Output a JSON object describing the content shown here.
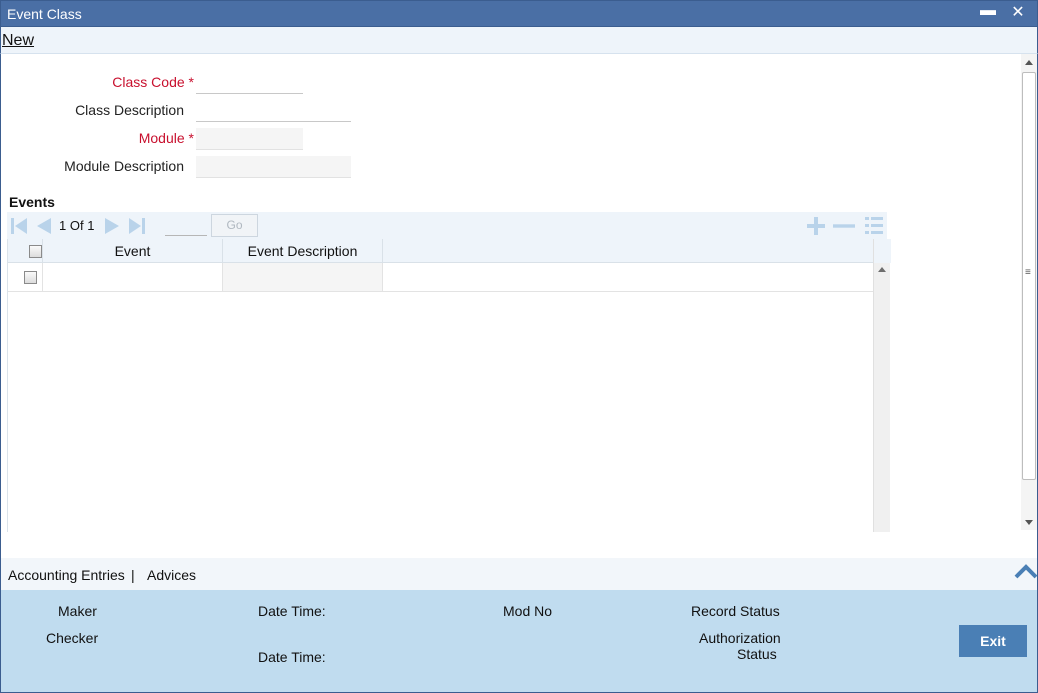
{
  "window": {
    "title": "Event Class",
    "minimize_icon": "minimize-icon",
    "close_icon": "close-icon"
  },
  "menu": {
    "new_label": "New"
  },
  "form": {
    "class_code_label": "Class Code",
    "class_code_value": "",
    "class_description_label": "Class Description",
    "class_description_value": "",
    "module_label": "Module",
    "module_value": "",
    "module_description_label": "Module Description",
    "module_description_value": "",
    "required_marker": "*",
    "required_color": "#c8102e"
  },
  "events": {
    "section_title": "Events",
    "pagination": {
      "current": "1",
      "of_label": "Of",
      "total": "1",
      "go_label": "Go"
    },
    "columns": [
      "Event",
      "Event Description"
    ],
    "rows": [
      {
        "event": "",
        "event_description": ""
      }
    ],
    "icons": [
      "first-page-icon",
      "prev-page-icon",
      "next-page-icon",
      "last-page-icon",
      "add-row-icon",
      "delete-row-icon",
      "single-view-icon"
    ]
  },
  "links": {
    "accounting_entries": "Accounting Entries",
    "separator": "|",
    "advices": "Advices"
  },
  "footer": {
    "maker_label": "Maker",
    "checker_label": "Checker",
    "date_time_label": "Date Time:",
    "mod_no_label": "Mod No",
    "record_status_label": "Record Status",
    "authorization_label": "Authorization",
    "status_label": "Status",
    "exit_label": "Exit"
  },
  "colors": {
    "title_bar": "#4a6fa5",
    "footer_bg": "#c0dcef",
    "exit_button": "#4a7fb5",
    "toolbar_bg": "#eef4fa"
  }
}
